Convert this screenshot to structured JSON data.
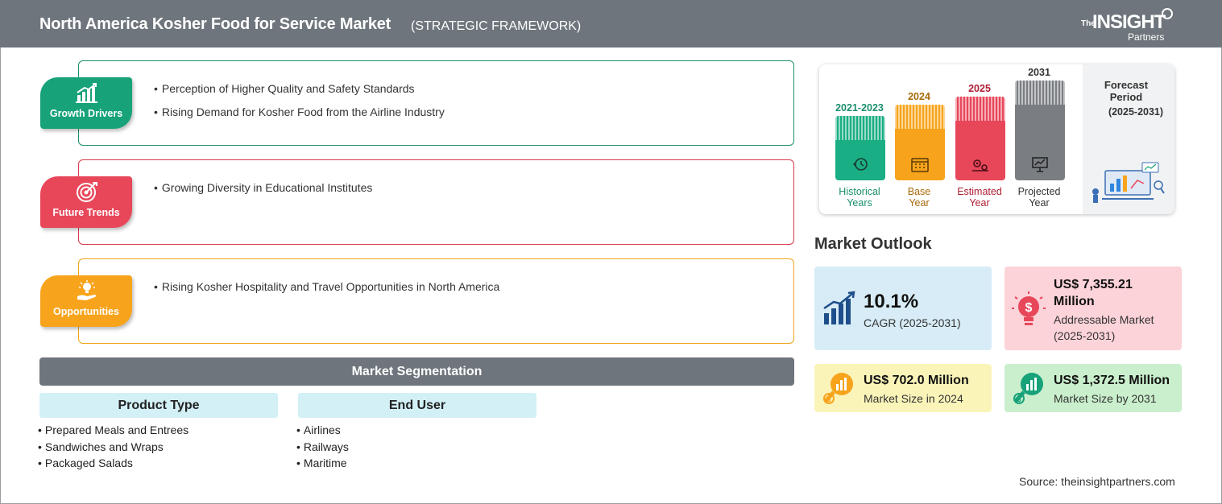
{
  "header": {
    "title": "North America Kosher Food for Service Market",
    "subtitle": "(STRATEGIC FRAMEWORK)",
    "logo_the": "The",
    "logo_main": "INSIGHT",
    "logo_partners": "Partners"
  },
  "framework": [
    {
      "label": "Growth Drivers",
      "color": "#17a27a",
      "icon": "growth-chart-icon",
      "items": [
        "Perception of Higher Quality and Safety Standards",
        "Rising Demand for Kosher Food from the Airline Industry"
      ]
    },
    {
      "label": "Future Trends",
      "color": "#e8475a",
      "icon": "target-icon",
      "items": [
        "Growing Diversity in Educational Institutes"
      ]
    },
    {
      "label": "Opportunities",
      "color": "#f7a41c",
      "icon": "lightbulb-hand-icon",
      "items": [
        "Rising Kosher Hospitality and Travel Opportunities in North America"
      ]
    }
  ],
  "segmentation": {
    "title": "Market Segmentation",
    "groups": [
      {
        "heading": "Product Type",
        "items": [
          "Prepared Meals and Entrees",
          "Sandwiches and Wraps",
          "Packaged Salads"
        ]
      },
      {
        "heading": "End User",
        "items": [
          "Airlines",
          "Railways",
          "Maritime"
        ]
      }
    ]
  },
  "timeline": {
    "periods": [
      {
        "year": "2021-2023",
        "label_line1": "Historical",
        "label_line2": "Years",
        "color": "#1aae84",
        "text_color": "#1a8f6c",
        "icon": "history-icon"
      },
      {
        "year": "2024",
        "label_line1": "Base",
        "label_line2": "Year",
        "color": "#f7a41c",
        "text_color": "#a86a0a",
        "icon": "calendar-icon"
      },
      {
        "year": "2025",
        "label_line1": "Estimated",
        "label_line2": "Year",
        "color": "#e8475a",
        "text_color": "#b02035",
        "icon": "gears-icon"
      },
      {
        "year": "2031",
        "label_line1": "Projected",
        "label_line2": "Year",
        "color": "#7a7e83",
        "text_color": "#333333",
        "icon": "presentation-icon"
      }
    ],
    "forecast_label_line1": "Forecast",
    "forecast_label_line2": "Period",
    "forecast_years": "(2025-2031)"
  },
  "outlook": {
    "title": "Market Outlook",
    "cagr_value": "10.1%",
    "cagr_label": "CAGR (2025-2031)",
    "addressable_value_line1": "US$ 7,355.21",
    "addressable_value_line2": "Million",
    "addressable_label_line1": "Addressable Market",
    "addressable_label_line2": "(2025-2031)",
    "size2024_value": "US$ 702.0 Million",
    "size2024_label": "Market Size in 2024",
    "size2031_value": "US$ 1,372.5 Million",
    "size2031_label": "Market Size by 2031",
    "colors": {
      "cagr": "#d7ecf6",
      "addressable": "#fbd3d9",
      "size2024": "#fbf4b9",
      "size2031": "#c9efcc"
    }
  },
  "source": "Source: theinsightpartners.com"
}
